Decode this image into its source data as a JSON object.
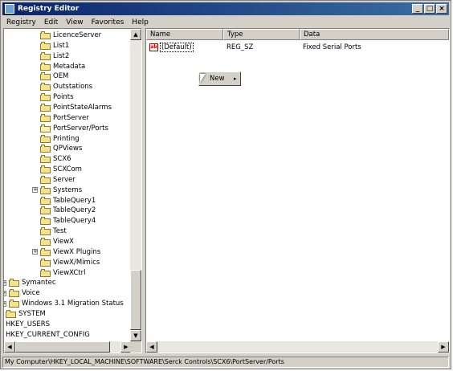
{
  "window": {
    "title": "Registry Editor",
    "minimize": "_",
    "maximize": "□",
    "close": "×"
  },
  "menu": [
    "Registry",
    "Edit",
    "View",
    "Favorites",
    "Help"
  ],
  "tree": [
    {
      "label": "LicenceServer",
      "depth": 2
    },
    {
      "label": "List1",
      "depth": 2
    },
    {
      "label": "List2",
      "depth": 2
    },
    {
      "label": "Metadata",
      "depth": 2
    },
    {
      "label": "OEM",
      "depth": 2
    },
    {
      "label": "Outstations",
      "depth": 2
    },
    {
      "label": "Points",
      "depth": 2
    },
    {
      "label": "PointStateAlarms",
      "depth": 2
    },
    {
      "label": "PortServer",
      "depth": 2
    },
    {
      "label": "PortServer/Ports",
      "depth": 2,
      "open": true
    },
    {
      "label": "Printing",
      "depth": 2
    },
    {
      "label": "QPViews",
      "depth": 2
    },
    {
      "label": "SCX6",
      "depth": 2
    },
    {
      "label": "SCXCom",
      "depth": 2
    },
    {
      "label": "Server",
      "depth": 2
    },
    {
      "label": "Systems",
      "depth": 2,
      "expandable": true
    },
    {
      "label": "TableQuery1",
      "depth": 2
    },
    {
      "label": "TableQuery2",
      "depth": 2
    },
    {
      "label": "TableQuery4",
      "depth": 2
    },
    {
      "label": "Test",
      "depth": 2
    },
    {
      "label": "ViewX",
      "depth": 2
    },
    {
      "label": "ViewX Plugins",
      "depth": 2,
      "expandable": true
    },
    {
      "label": "ViewX/Mimics",
      "depth": 2
    },
    {
      "label": "ViewXCtrl",
      "depth": 2
    },
    {
      "label": "Symantec",
      "depth": 1,
      "expandable": true
    },
    {
      "label": "Voice",
      "depth": 1,
      "expandable": true
    },
    {
      "label": "Windows 3.1 Migration Status",
      "depth": 1,
      "expandable": true
    },
    {
      "label": "SYSTEM",
      "depth": 0
    },
    {
      "label": "HKEY_USERS",
      "depth": 0,
      "root": true
    },
    {
      "label": "HKEY_CURRENT_CONFIG",
      "depth": 0,
      "root": true
    }
  ],
  "columns": [
    "Name",
    "Type",
    "Data"
  ],
  "values": [
    {
      "name": "(Default)",
      "type": "REG_SZ",
      "data": "Fixed Serial Ports",
      "icon": "ab-string-icon"
    }
  ],
  "context_menu": {
    "label": "New",
    "arrow": "▸"
  },
  "scroll": {
    "up": "▲",
    "down": "▼",
    "left": "◀",
    "right": "▶"
  },
  "status": "My Computer\\HKEY_LOCAL_MACHINE\\SOFTWARE\\Serck Controls\\SCX6\\PortServer/Ports"
}
